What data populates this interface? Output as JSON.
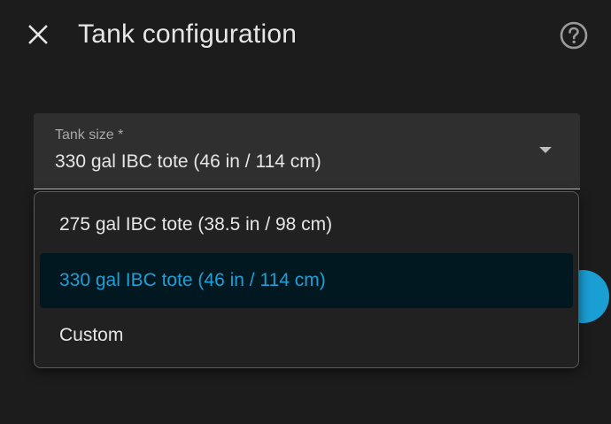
{
  "header": {
    "title": "Tank configuration",
    "close_icon": "close-icon",
    "help_icon": "help-circle-icon"
  },
  "select": {
    "label": "Tank size *",
    "value": "330 gal IBC tote (46 in / 114 cm)",
    "arrow_icon": "dropdown-arrow-icon"
  },
  "menu": {
    "items": [
      {
        "label": "275 gal IBC tote (38.5 in / 98 cm)",
        "selected": false
      },
      {
        "label": "330 gal IBC tote (46 in / 114 cm)",
        "selected": true
      },
      {
        "label": "Custom",
        "selected": false
      }
    ]
  },
  "colors": {
    "background": "#1c1c1c",
    "field_background": "#2f2f2f",
    "accent": "#1e9fd6",
    "selected_background": "#021821",
    "text": "#e6e6e6",
    "label_text": "#a8a8a8"
  }
}
